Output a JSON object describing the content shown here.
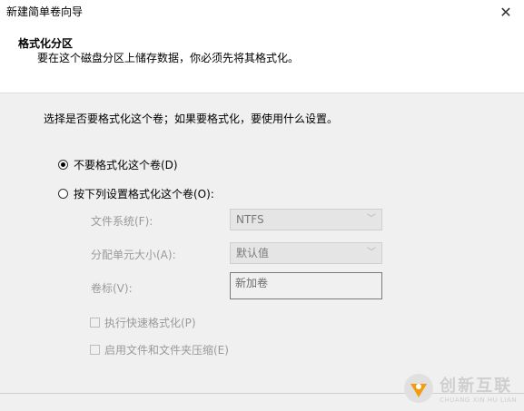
{
  "window": {
    "title": "新建简单卷向导",
    "close_glyph": "✕"
  },
  "header": {
    "title": "格式化分区",
    "subtitle": "要在这个磁盘分区上储存数据，你必须先将其格式化。"
  },
  "main": {
    "instruction": "选择是否要格式化这个卷；如果要格式化，要使用什么设置。",
    "options": [
      {
        "label": "不要格式化这个卷(D)",
        "checked": true
      },
      {
        "label": "按下列设置格式化这个卷(O):",
        "checked": false
      }
    ],
    "format_settings": {
      "file_system_label": "文件系统(F):",
      "file_system_value": "NTFS",
      "allocation_unit_label": "分配单元大小(A):",
      "allocation_unit_value": "默认值",
      "volume_label_label": "卷标(V):",
      "volume_label_value": "新加卷",
      "quick_format_label": "执行快速格式化(P)",
      "compression_label": "启用文件和文件夹压缩(E)"
    }
  },
  "watermark": {
    "text": "创新互联",
    "subtext": "CHUANG XIN HU LIAN",
    "colors": {
      "orange": "#f39c12",
      "gray": "#cfcfcf"
    }
  }
}
